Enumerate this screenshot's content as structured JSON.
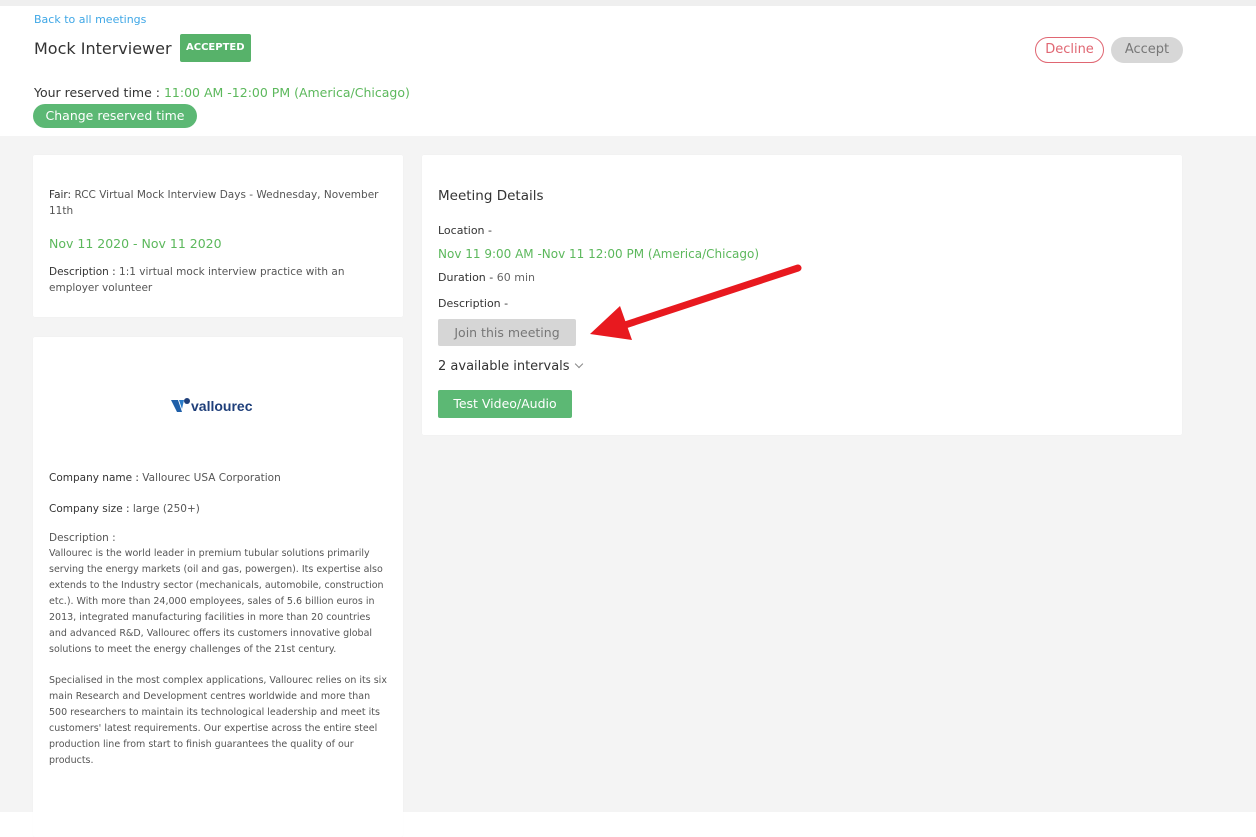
{
  "header": {
    "back_link": "Back to all meetings",
    "title": "Mock Interviewer",
    "status_badge": "ACCEPTED",
    "decline_label": "Decline",
    "accept_label": "Accept",
    "reserved_label": "Your reserved time :",
    "reserved_value": "11:00 AM -12:00 PM (America/Chicago)",
    "change_time_label": "Change reserved time"
  },
  "fair": {
    "label": "Fair:",
    "name": "RCC Virtual Mock Interview Days - Wednesday, November 11th",
    "dates": "Nov 11 2020 - Nov 11 2020",
    "description_label": "Description :",
    "description": "1:1 virtual mock interview practice with an employer volunteer"
  },
  "company": {
    "logo_text": "vallourec",
    "name_label": "Company name :",
    "name": "Vallourec USA Corporation",
    "size_label": "Company size :",
    "size": "large (250+)",
    "description_label": "Description :",
    "description_p1": "Vallourec is the world leader in premium tubular solutions primarily serving the energy markets (oil and gas, powergen). Its expertise also extends to the Industry sector (mechanicals, automobile, construction etc.). With more than 24,000 employees, sales of 5.6 billion euros in 2013, integrated manufacturing facilities in more than 20 countries and advanced R&D, Vallourec offers its customers innovative global solutions to meet the energy challenges of the 21st century.",
    "description_p2": "Specialised in the most complex applications, Vallourec relies on its six main Research and Development centres worldwide and more than 500 researchers to maintain its technological leadership and meet its customers' latest requirements. Our expertise across the entire steel production line from start to finish guarantees the quality of our products."
  },
  "meeting": {
    "title": "Meeting Details",
    "location_label": "Location -",
    "time": "Nov 11 9:00 AM -Nov 11 12:00 PM (America/Chicago)",
    "duration_label": "Duration -",
    "duration_value": "60 min",
    "description_label": "Description -",
    "join_label": "Join this meeting",
    "intervals_label": "2 available intervals",
    "test_label": "Test Video/Audio"
  },
  "colors": {
    "accent_green": "#5cb874",
    "link_blue": "#3fa7e6",
    "decline_red": "#e06672",
    "arrow_red": "#e8191f"
  }
}
